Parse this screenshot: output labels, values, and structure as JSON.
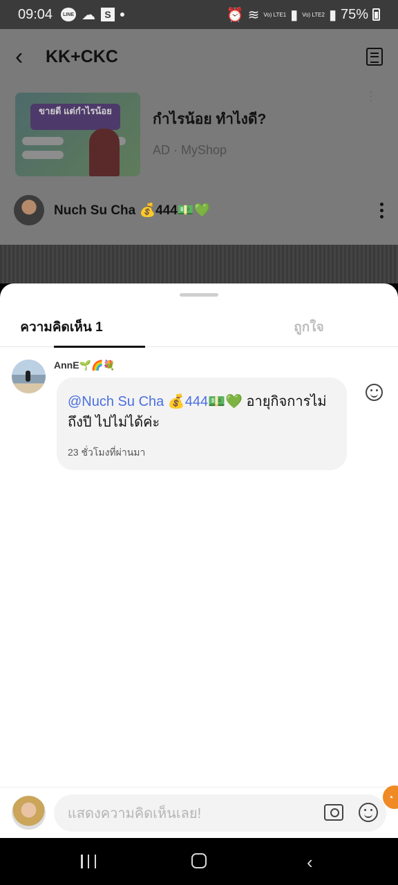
{
  "status_bar": {
    "time": "09:04",
    "line_badge": "LINE",
    "s_badge": "S",
    "sim1": "Vo) LTE1",
    "sim2": "Vo) LTE2",
    "battery": "75%"
  },
  "header": {
    "title": "KK+CKC",
    "back_icon": "back-arrow-icon",
    "memo_icon": "memo-icon"
  },
  "ad": {
    "thumb_headline": "ขายดี แต่กำไรน้อย",
    "title": "กำไรน้อย ทำไงดี?",
    "sponsor": "AD · MyShop"
  },
  "post_author": {
    "name": "Nuch Su Cha 💰444💵💚"
  },
  "sheet": {
    "tabs": [
      {
        "label": "ความคิดเห็น 1",
        "active": true
      },
      {
        "label": "ถูกใจ",
        "active": false
      }
    ],
    "comments": [
      {
        "author": "AnnE🌱🌈💐",
        "mention": "@Nuch Su Cha 💰444💵💚",
        "text": " อายุกิจการไม่ถึงปี ไปไม่ได้ค่ะ",
        "time": "23 ชั่วโมงที่ผ่านมา"
      }
    ],
    "composer": {
      "placeholder": "แสดงความคิดเห็นเลย!"
    }
  },
  "colors": {
    "mention": "#4a6fe0",
    "accent_orange": "#f08a24",
    "dim_overlay": "#7a7a7a"
  }
}
